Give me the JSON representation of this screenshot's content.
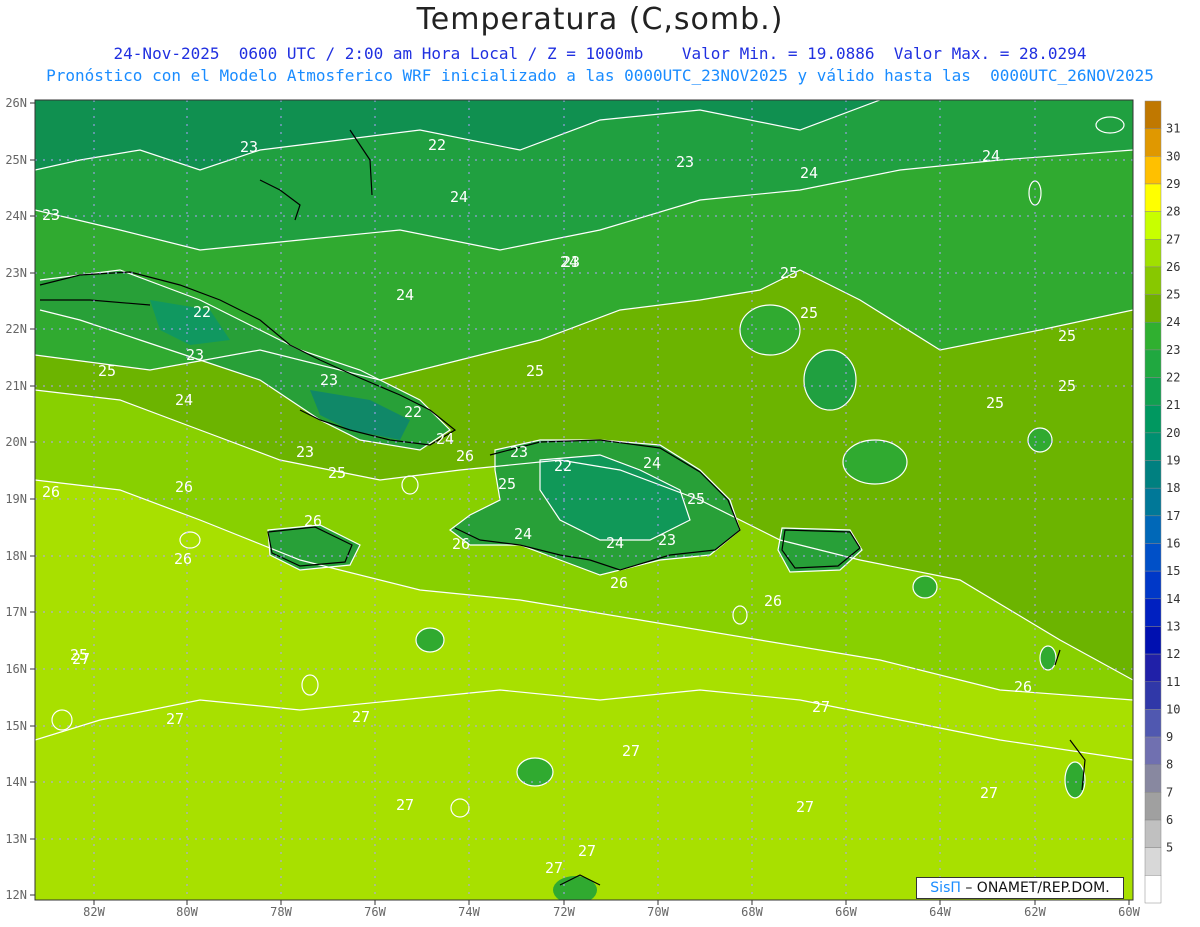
{
  "title": "Temperatura (C,somb.)",
  "subtitle1": "24-Nov-2025  0600 UTC / 2:00 am Hora Local / Z = 1000mb    Valor Min. = 19.0886  Valor Max. = 28.0294",
  "subtitle2": "Pronóstico con el Modelo Atmosferico WRF inicializado a las 0000UTC_23NOV2025 y válido hasta las  0000UTC_26NOV2025",
  "credit": {
    "brand": "SisΠ",
    "text": " – ONAMET/REP.DOM."
  },
  "lat_labels": [
    "26N",
    "25N",
    "24N",
    "23N",
    "22N",
    "21N",
    "20N",
    "19N",
    "18N",
    "17N",
    "16N",
    "15N",
    "14N",
    "13N",
    "12N"
  ],
  "lon_labels": [
    "82W",
    "80W",
    "78W",
    "76W",
    "74W",
    "72W",
    "70W",
    "68W",
    "66W",
    "64W",
    "62W",
    "60W"
  ],
  "colorbar": {
    "labels": [
      "31",
      "30",
      "29",
      "28",
      "27",
      "26",
      "25",
      "24",
      "23",
      "22",
      "21",
      "20",
      "19",
      "18",
      "17",
      "16",
      "15",
      "14",
      "13",
      "12",
      "11",
      "10",
      "9",
      "8",
      "7",
      "6",
      "5"
    ],
    "colors": [
      "#c07800",
      "#e09800",
      "#f0b800",
      "#ffe000",
      "#ffff00",
      "#c8ff00",
      "#a0e000",
      "#88c800",
      "#60a800",
      "#40a030",
      "#20a040",
      "#109850",
      "#009060",
      "#008070",
      "#007890",
      "#0068b0",
      "#0050c8",
      "#0040d0",
      "#0030c8",
      "#0020b8",
      "#1020a8",
      "#2030a0",
      "#4050b0",
      "#7070b0",
      "#9090a0",
      "#b0b0b0",
      "#d8d8d8",
      "#ffffff"
    ],
    "swatches": [
      "#c07800",
      "#e09800",
      "#ffc000",
      "#ffff00",
      "#c8ff00",
      "#a0e000",
      "#88c800",
      "#70b000",
      "#30b030",
      "#20a840",
      "#10a050",
      "#009860",
      "#009070",
      "#008080",
      "#007898",
      "#0068b8",
      "#0050c8",
      "#0038c8",
      "#0020c0",
      "#0010b0",
      "#2020a8",
      "#3038a8",
      "#5058b0",
      "#7070b0",
      "#8888a0",
      "#a0a0a0",
      "#c0c0c0",
      "#d8d8d8",
      "#ffffff"
    ]
  },
  "contour_labels": [
    {
      "t": "23"
    },
    {
      "t": "22"
    },
    {
      "t": "23"
    },
    {
      "t": "24"
    },
    {
      "t": "23"
    },
    {
      "t": "23"
    },
    {
      "t": "24"
    },
    {
      "t": "24"
    },
    {
      "t": "25"
    },
    {
      "t": "24"
    },
    {
      "t": "22"
    },
    {
      "t": "23"
    },
    {
      "t": "25"
    },
    {
      "t": "24"
    },
    {
      "t": "23"
    },
    {
      "t": "22"
    },
    {
      "t": "24"
    },
    {
      "t": "23"
    },
    {
      "t": "25"
    },
    {
      "t": "26"
    },
    {
      "t": "25"
    },
    {
      "t": "25"
    },
    {
      "t": "26"
    },
    {
      "t": "26"
    },
    {
      "t": "26"
    },
    {
      "t": "23"
    },
    {
      "t": "22"
    },
    {
      "t": "24"
    },
    {
      "t": "25"
    },
    {
      "t": "25"
    },
    {
      "t": "24"
    },
    {
      "t": "24"
    },
    {
      "t": "23"
    },
    {
      "t": "26"
    },
    {
      "t": "26"
    },
    {
      "t": "25"
    },
    {
      "t": "25"
    },
    {
      "t": "25"
    },
    {
      "t": "25"
    },
    {
      "t": "26"
    },
    {
      "t": "26"
    },
    {
      "t": "27"
    },
    {
      "t": "27"
    },
    {
      "t": "27"
    },
    {
      "t": "27"
    },
    {
      "t": "27"
    },
    {
      "t": "27"
    },
    {
      "t": "27"
    },
    {
      "t": "27"
    },
    {
      "t": "27"
    },
    {
      "t": "26"
    },
    {
      "t": "27"
    },
    {
      "t": "24"
    }
  ]
}
